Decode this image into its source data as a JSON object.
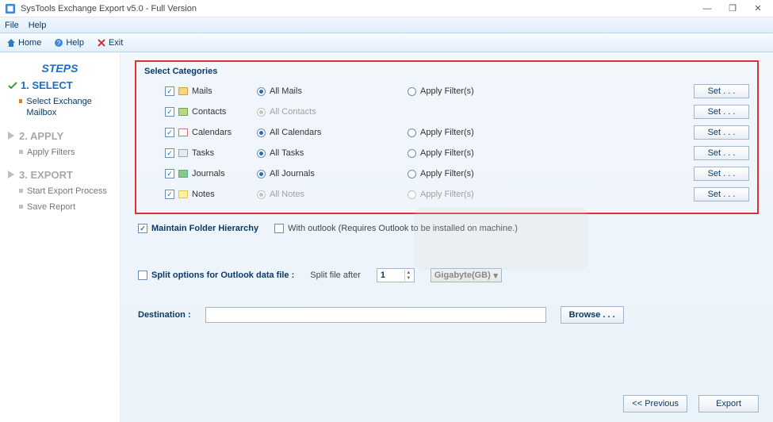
{
  "window": {
    "title": "SysTools Exchange Export v5.0 - Full Version",
    "minimize": "—",
    "maximize": "❐",
    "close": "✕"
  },
  "menu": {
    "file": "File",
    "help": "Help"
  },
  "toolbar": {
    "home": "Home",
    "help": "Help",
    "exit": "Exit"
  },
  "sidebar": {
    "steps_label": "STEPS",
    "step1": {
      "label": "1. SELECT",
      "sub": "Select Exchange Mailbox"
    },
    "step2": {
      "label": "2. APPLY",
      "sub": "Apply Filters"
    },
    "step3": {
      "label": "3. EXPORT",
      "sub1": "Start Export Process",
      "sub2": "Save Report"
    }
  },
  "panel": {
    "title": "Select Categories",
    "set_label": "Set . . .",
    "cats": [
      {
        "name": "Mails",
        "checked": true,
        "all_label": "All Mails",
        "all_selected": true,
        "all_disabled": false,
        "apply_label": "Apply Filter(s)",
        "apply_disabled": false
      },
      {
        "name": "Contacts",
        "checked": true,
        "all_label": "All Contacts",
        "all_selected": true,
        "all_disabled": true,
        "apply_label": "",
        "apply_disabled": true
      },
      {
        "name": "Calendars",
        "checked": true,
        "all_label": "All Calendars",
        "all_selected": true,
        "all_disabled": false,
        "apply_label": "Apply Filter(s)",
        "apply_disabled": false
      },
      {
        "name": "Tasks",
        "checked": true,
        "all_label": "All Tasks",
        "all_selected": true,
        "all_disabled": false,
        "apply_label": "Apply Filter(s)",
        "apply_disabled": false
      },
      {
        "name": "Journals",
        "checked": true,
        "all_label": "All Journals",
        "all_selected": true,
        "all_disabled": false,
        "apply_label": "Apply Filter(s)",
        "apply_disabled": false
      },
      {
        "name": "Notes",
        "checked": true,
        "all_label": "All Notes",
        "all_selected": true,
        "all_disabled": true,
        "apply_label": "Apply Filter(s)",
        "apply_disabled": true
      }
    ],
    "maintain_label": "Maintain Folder Hierarchy",
    "maintain_checked": true,
    "with_outlook_label": "With outlook (Requires Outlook to be installed on machine.)",
    "with_outlook_checked": false,
    "split_label": "Split options for Outlook data file :",
    "split_checked": false,
    "split_after_label": "Split file after",
    "split_value": "1",
    "split_unit": "Gigabyte(GB)",
    "destination_label": "Destination :",
    "destination_value": "",
    "browse_label": "Browse . . .",
    "prev_label": "<< Previous",
    "export_label": "Export"
  }
}
